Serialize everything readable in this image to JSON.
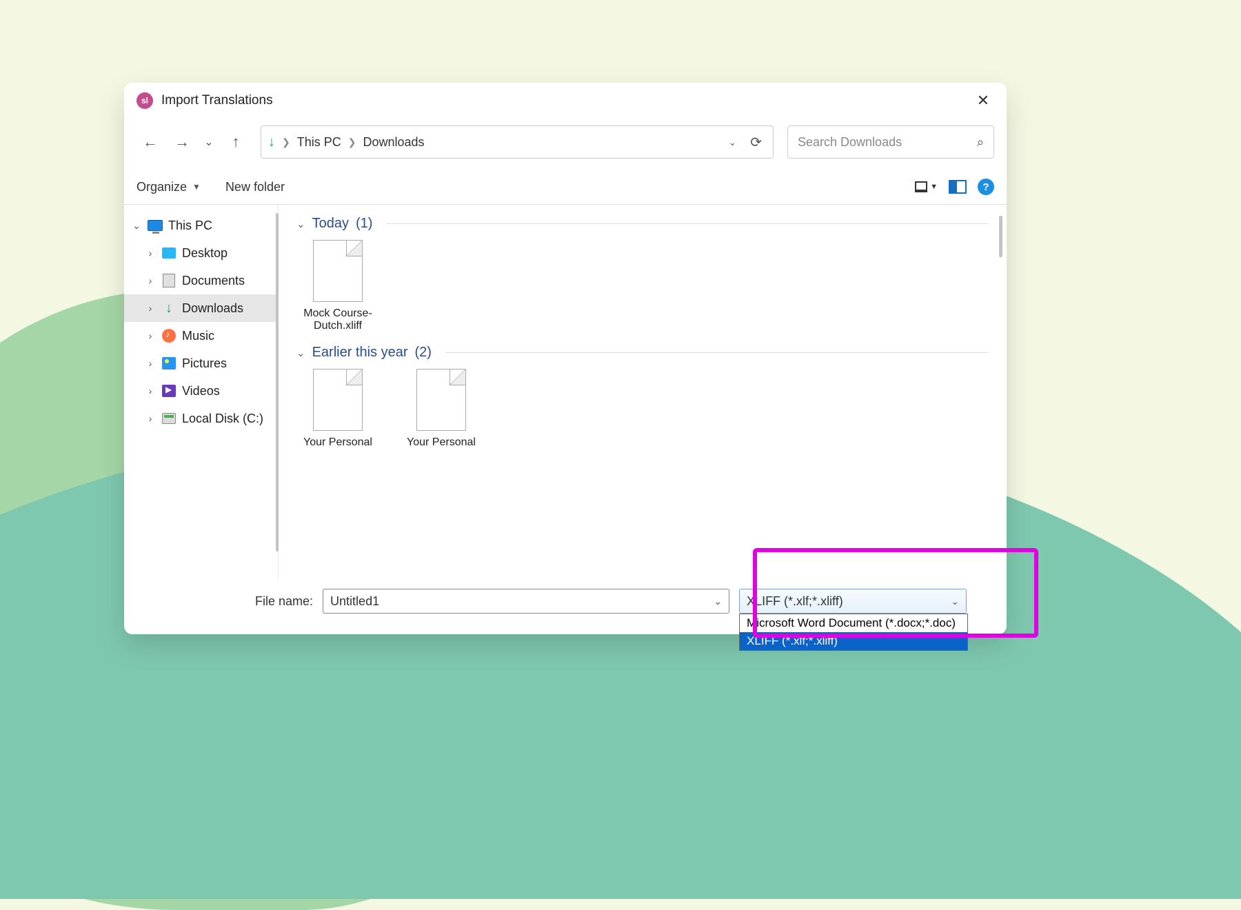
{
  "dialog": {
    "app_icon_text": "sl",
    "title": "Import Translations"
  },
  "address": {
    "crumb1": "This PC",
    "crumb2": "Downloads"
  },
  "search": {
    "placeholder": "Search Downloads"
  },
  "toolbar": {
    "organize": "Organize",
    "new_folder": "New folder"
  },
  "sidebar": {
    "root": "This PC",
    "items": [
      {
        "label": "Desktop"
      },
      {
        "label": "Documents"
      },
      {
        "label": "Downloads"
      },
      {
        "label": "Music"
      },
      {
        "label": "Pictures"
      },
      {
        "label": "Videos"
      },
      {
        "label": "Local Disk (C:)"
      }
    ]
  },
  "groups": [
    {
      "label": "Today",
      "count": "(1)",
      "files": [
        "Mock Course-Dutch.xliff"
      ]
    },
    {
      "label": "Earlier this year",
      "count": "(2)",
      "files": [
        "Your Personal",
        "Your Personal"
      ]
    }
  ],
  "footer": {
    "file_name_label": "File name:",
    "file_name_value": "Untitled1",
    "file_type_selected": "XLIFF (*.xlf;*.xliff)",
    "file_type_options": [
      "Microsoft Word Document (*.docx;*.doc)",
      "XLIFF (*.xlf;*.xliff)"
    ]
  }
}
